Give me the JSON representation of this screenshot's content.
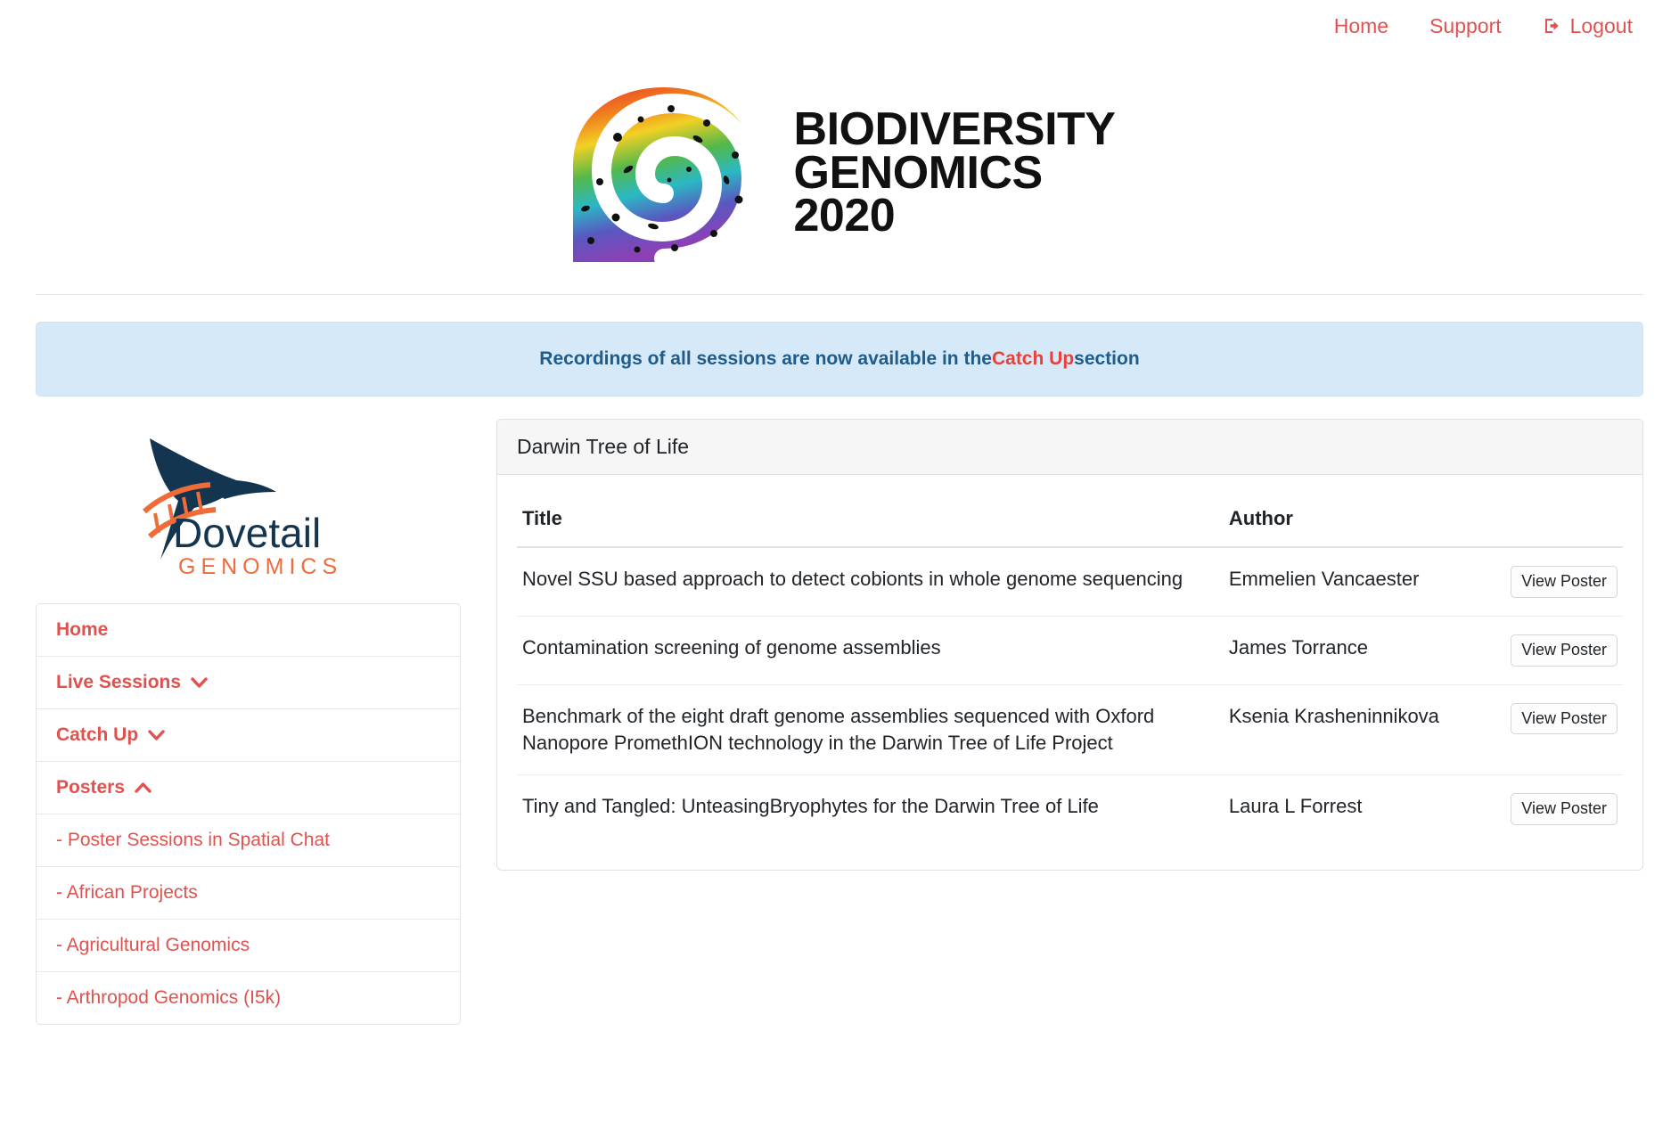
{
  "topnav": {
    "items": [
      {
        "label": "Home",
        "icon": null
      },
      {
        "label": "Support",
        "icon": null
      },
      {
        "label": "Logout",
        "icon": "sign-out-icon"
      }
    ]
  },
  "header": {
    "logo_alt": "Biodiversity Genomics 2020",
    "brand_line1": "BIODIVERSITY",
    "brand_line2": "GENOMICS",
    "brand_line3": "2020"
  },
  "alert": {
    "text_before": "Recordings of all sessions are now available in the ",
    "highlight": "Catch Up",
    "text_after": " section",
    "bg_color": "#d6e9f8",
    "text_color": "#1f5c8b",
    "highlight_color": "#e8413c"
  },
  "sidebar": {
    "sponsor_logo": {
      "name": "Dovetail",
      "subtitle": "GENOMICS",
      "name_color": "#14354f",
      "subtitle_color": "#ef6c38"
    },
    "accent_color": "#e0524f",
    "items": [
      {
        "label": "Home",
        "icon": null,
        "level": "top"
      },
      {
        "label": "Live Sessions",
        "icon": "chevron-down-icon",
        "level": "top"
      },
      {
        "label": "Catch Up",
        "icon": "chevron-down-icon",
        "level": "top"
      },
      {
        "label": "Posters",
        "icon": "chevron-up-icon",
        "level": "top"
      },
      {
        "label": "- Poster Sessions in Spatial Chat",
        "icon": null,
        "level": "sub"
      },
      {
        "label": "- African Projects",
        "icon": null,
        "level": "sub"
      },
      {
        "label": "- Agricultural Genomics",
        "icon": null,
        "level": "sub"
      },
      {
        "label": "- Arthropod Genomics (I5k)",
        "icon": null,
        "level": "sub"
      }
    ]
  },
  "main": {
    "card_title": "Darwin Tree of Life",
    "table": {
      "columns": [
        "Title",
        "Author",
        ""
      ],
      "action_label": "View Poster",
      "rows": [
        {
          "title": "Novel SSU based approach to detect cobionts in whole genome sequencing",
          "author": "Emmelien Vancaester",
          "action": "View Poster"
        },
        {
          "title": "Contamination screening of genome assemblies",
          "author": "James Torrance",
          "action": "View Poster"
        },
        {
          "title": "Benchmark of the eight draft genome assemblies sequenced with Oxford Nanopore PromethION technology in the Darwin Tree of Life Project",
          "author": "Ksenia Krasheninnikova",
          "action": "View Poster"
        },
        {
          "title": "Tiny and Tangled: UnteasingBryophytes for the Darwin Tree of Life",
          "author": "Laura L Forrest",
          "action": "View Poster"
        }
      ]
    }
  }
}
